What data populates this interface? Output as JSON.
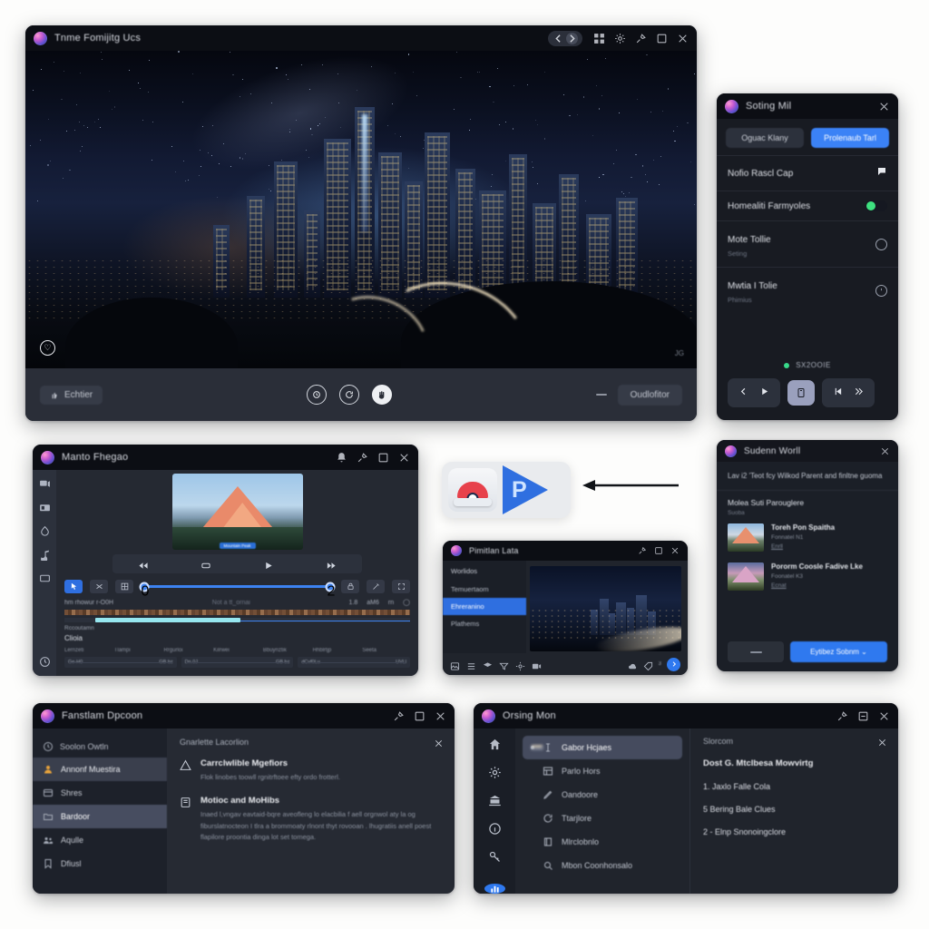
{
  "canvas": {
    "background": "#fdfdfc"
  },
  "accents": {
    "blue": "#2f79ef",
    "green": "#3ee07f",
    "cyan": "#96e6ef",
    "selection": "#474d60"
  },
  "player_window": {
    "title": "Tnme Fomijitg Ucs",
    "nav": {
      "back_icon": "chevron-left-icon",
      "forward_icon": "chevron-right-icon"
    },
    "titlebar_icons": [
      "grid-icon",
      "cog-icon",
      "pin-icon",
      "maximize-icon",
      "close-icon"
    ],
    "video": {
      "badge_icon": "heart-circle-icon",
      "watermark": "JG"
    },
    "controls": {
      "left_chip_label": "Echtier",
      "left_chip_icon": "thumb-icon",
      "center_icons": [
        "speed-circle-icon",
        "refresh-icon",
        "hand-icon"
      ],
      "minus_label": "—",
      "right_button_label": "Oudlofitor"
    }
  },
  "settings_card": {
    "title": "Soting Mil",
    "close_icon": "close-icon",
    "tabs": [
      {
        "label": "Oguac Klany",
        "active": false
      },
      {
        "label": "Prolenaub Tarl",
        "active": true
      }
    ],
    "rows": [
      {
        "label": "Nofio Rascl Cap",
        "control": "speech-bubble-icon"
      },
      {
        "label": "Homealiti Farmyoles",
        "control": "toggle-on"
      },
      {
        "label": "Mote Tollie",
        "sub": "Seting",
        "control": "ring-icon"
      },
      {
        "label": "Mwtia I Tolie",
        "sub": "Phimius",
        "control": "power-ring-icon"
      }
    ],
    "status": {
      "dot": "online-dot",
      "text": "SX2OOIE"
    },
    "transport": {
      "prev_icon": "chevron-left-icon",
      "play_icon": "play-icon",
      "capture_icon": "capture-icon",
      "skip_back_icon": "skip-back-icon",
      "fast_forward_icon": "fast-forward-icon"
    }
  },
  "editor_window": {
    "title": "Manto Fhegao",
    "titlebar_icons": [
      "bell-icon",
      "pin-icon",
      "maximize-icon",
      "close-icon"
    ],
    "rail_icons": [
      "media-icon",
      "library-icon",
      "shapes-icon",
      "audio-icon",
      "export-icon",
      "clock-icon"
    ],
    "preview": {
      "badge": "Mountain Peak"
    },
    "transport_icons": [
      "rewind-icon",
      "loop-icon",
      "play-icon",
      "skip-end-icon"
    ],
    "tools": [
      {
        "icon": "cursor-icon",
        "active": true
      },
      {
        "icon": "cut-icon",
        "active": false
      },
      {
        "icon": "grid-icon",
        "active": false
      }
    ],
    "slider": {
      "start_handle": "0",
      "end_handle": "2"
    },
    "right_tools": [
      "lock-icon",
      "wand-icon",
      "fullscreen-icon"
    ],
    "meta_left": "hm rhowur r-O0H",
    "meta_center": "Not a tt_ornai",
    "meta_right": [
      "1.8",
      "aM6",
      "rn",
      "cam-icon"
    ],
    "clip_label": "Rccoutamn",
    "clip_sub": "Clioia",
    "columns": [
      "Lernzeti",
      "Tlampi",
      "Rrgurloi",
      "Kilrwei",
      "Bbuynztik",
      "Hhblrtjp",
      "Seeta"
    ],
    "panes": [
      {
        "left": "Ge-H0",
        "right": "GB bz"
      },
      {
        "left": "Dn.0J",
        "right": "GB bz"
      },
      {
        "left": "dCvf0Lu",
        "right": "UVLl"
      }
    ]
  },
  "logo_block": {
    "app_icon": "red-cap-icon",
    "play_icon": "play-p-icon",
    "play_letter": "P",
    "arrow_icon": "arrow-left-icon"
  },
  "browser_window": {
    "title": "Pimitlan Lata",
    "titlebar_icons": [
      "pin-icon",
      "maximize-icon",
      "close-icon"
    ],
    "sidebar_header": "Worlidos",
    "sidebar_items": [
      {
        "label": "Temuertaom",
        "selected": false
      },
      {
        "label": "Ehreranino",
        "selected": true
      },
      {
        "label": "Plathems",
        "selected": false
      }
    ],
    "footer_icons": [
      "image-icon",
      "list-icon",
      "layers-icon",
      "filter-icon",
      "gear-icon",
      "video-icon"
    ],
    "footer_right": {
      "icons": [
        "cloud-icon",
        "tag-icon"
      ],
      "count": "3",
      "fab_icon": "chevron-right-icon"
    }
  },
  "list_window": {
    "title": "Sudenn Worll",
    "close_icon": "close-icon",
    "lead": "Lav i2 'Teot fcy Wilkod Parent and finltne guoma",
    "section": {
      "title": "Molea Suti Parouglere",
      "sub": "Suoba"
    },
    "items": [
      {
        "thumb": "mountain-thumb",
        "title": "Toreh Pon Spaitha",
        "sub": "Fonnatel N1",
        "link": "Enrll"
      },
      {
        "thumb": "mountain-thumb-alt",
        "title": "Pororm Coosle Fadive Lke",
        "sub": "Foonatel K3",
        "link": "Ecnat"
      }
    ],
    "footer": {
      "ghost_label": "—",
      "primary_label": "Eytibez Sobnm  ⌄"
    }
  },
  "options_window": {
    "title": "Fanstlam Dpcoon",
    "titlebar_icons": [
      "pin-icon",
      "maximize-icon",
      "close-icon"
    ],
    "nav_header": {
      "label": "Soolon Owtln",
      "icon": "clock-icon"
    },
    "nav_items": [
      {
        "label": "Annonf Muestira",
        "icon": "user-icon",
        "state": "selected-light"
      },
      {
        "label": "Shres",
        "icon": "card-icon",
        "state": "none"
      },
      {
        "label": "Bardoor",
        "icon": "folder-icon",
        "state": "selected"
      },
      {
        "label": "Aqulle",
        "icon": "people-icon",
        "state": "none"
      },
      {
        "label": "Dfiusl",
        "icon": "bookmark-icon",
        "state": "none"
      }
    ],
    "content_header": "Gnarlette Lacorlion",
    "close_icon": "close-icon",
    "blocks": [
      {
        "icon": "warning-triangle-icon",
        "title": "Carrclwlible Mgefiors",
        "body": "Flok linobes toowll rgnitrftoee efty ordo frotterl."
      },
      {
        "icon": "document-icon",
        "title": "Motioc and MoHibs",
        "body": "Inaed l,vngav eavtaid-bqre aveofleng lo elacbilia f aell orgnwol aty la og fiburslatnocteon I tlra a brommoaty rlnont thyt rovooan . lhugratiis anell poest flapilore proontia dinga lot set tomega."
      }
    ]
  },
  "manager_window": {
    "title": "Orsing Mon",
    "titlebar_icons": [
      "pin-icon",
      "minimize-icon",
      "close-icon"
    ],
    "rail_icons": [
      "home-icon",
      "settings-gear-icon",
      "library-icon",
      "info-icon",
      "key-icon"
    ],
    "rail_fab": "analytics-icon",
    "list_items": [
      {
        "label": "Gabor Hcjaes",
        "icon": "text-cursor-icon",
        "selected": true
      },
      {
        "label": "Parlo Hors",
        "icon": "table-icon",
        "selected": false
      },
      {
        "label": "Oandoore",
        "icon": "pencil-icon",
        "selected": false
      },
      {
        "label": "Ttarjlore",
        "icon": "refresh-icon",
        "selected": false
      },
      {
        "label": "Mlrclobnlo",
        "icon": "book-icon",
        "selected": false
      },
      {
        "label": "Mbon Coonhonsalo",
        "icon": "search-icon",
        "selected": false
      }
    ],
    "detail": {
      "header": "Slorcom",
      "close_icon": "close-icon",
      "title": "Dost G. Mtclbesa Mowvirtg",
      "lines": [
        "1. Jaxlo Falle Cola",
        "5 Bering Bale Clues",
        "2 - Elnp Snonoingclore"
      ]
    }
  }
}
